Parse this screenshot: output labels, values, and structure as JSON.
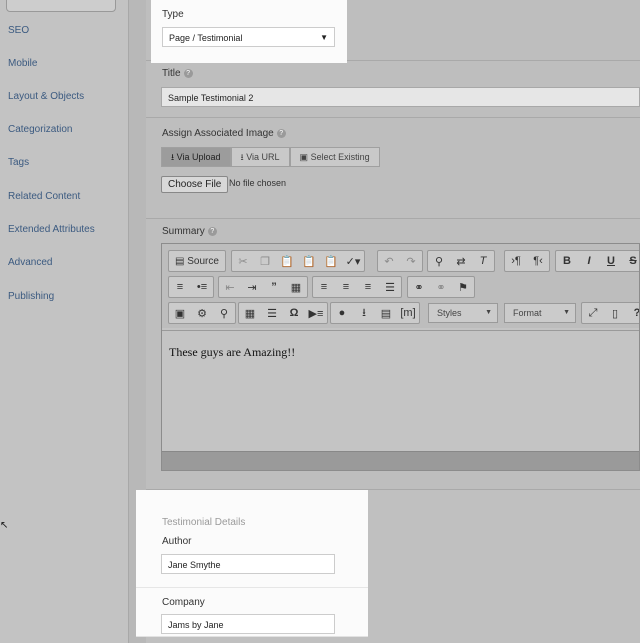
{
  "sidebar": {
    "items": [
      {
        "label": "SEO"
      },
      {
        "label": "Mobile"
      },
      {
        "label": "Layout & Objects"
      },
      {
        "label": "Categorization"
      },
      {
        "label": "Tags"
      },
      {
        "label": "Related Content"
      },
      {
        "label": "Extended Attributes"
      },
      {
        "label": "Advanced"
      },
      {
        "label": "Publishing"
      }
    ]
  },
  "form": {
    "type": {
      "label": "Type",
      "value": "Page / Testimonial"
    },
    "title": {
      "label": "Title",
      "value": "Sample Testimonial 2"
    },
    "image": {
      "label": "Assign Associated Image",
      "buttons": [
        "Via Upload",
        "Via URL",
        "Select Existing"
      ],
      "choose_label": "Choose File",
      "no_file": "No file chosen"
    },
    "summary": {
      "label": "Summary",
      "source_label": "Source",
      "styles_label": "Styles",
      "format_label": "Format",
      "content": "These guys are Amazing!!"
    },
    "testimonial": {
      "heading": "Testimonial Details",
      "author_label": "Author",
      "author_value": "Jane Smythe",
      "company_label": "Company",
      "company_value": "Jams by Jane"
    }
  },
  "colors": {
    "link": "#3b5a80",
    "highlight": "#fbfbfb",
    "dimmed_bg": "#b4b4b4"
  }
}
